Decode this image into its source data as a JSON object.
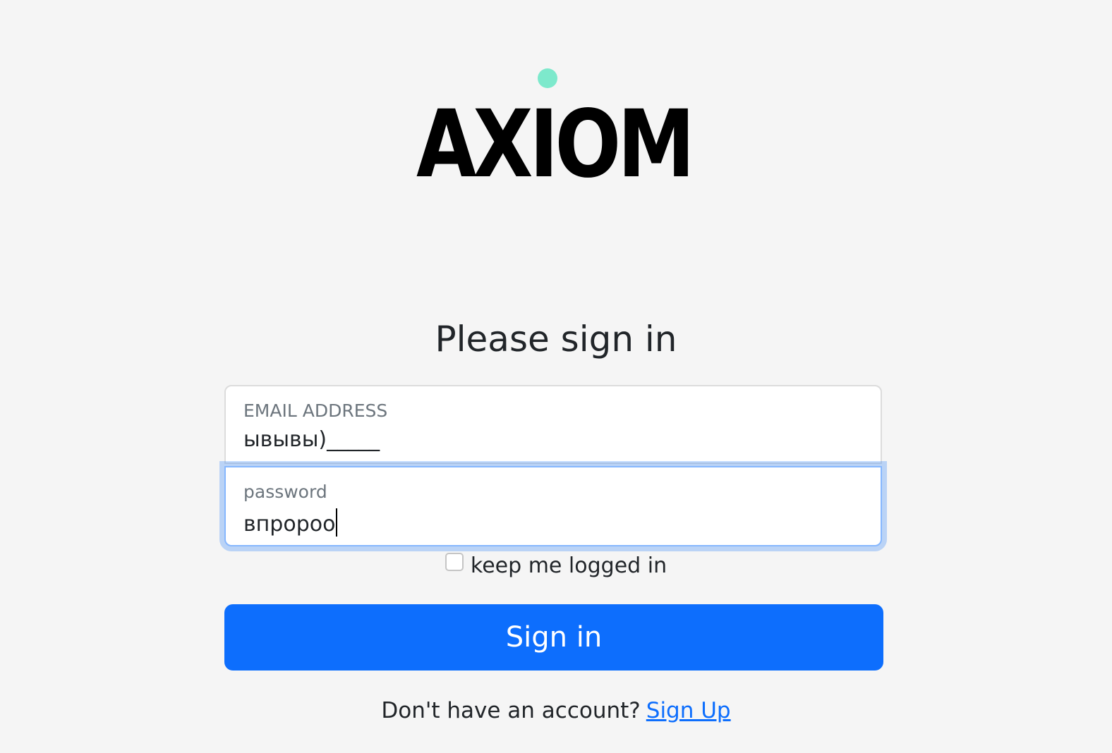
{
  "logo": {
    "text": "AXIOM",
    "dot_color": "#7de9cc"
  },
  "heading": "Please sign in",
  "email": {
    "label": "EMAIL ADDRESS",
    "value": "ывывы)_____"
  },
  "password": {
    "label": "password",
    "value": "впророо"
  },
  "remember": {
    "label": "keep me logged in",
    "checked": false
  },
  "signin_button": "Sign in",
  "signup": {
    "prompt": "Don't have an account?",
    "link": "Sign Up"
  },
  "colors": {
    "primary": "#0d6efd",
    "background": "#f5f5f5",
    "focus_border": "#86b7fe"
  }
}
